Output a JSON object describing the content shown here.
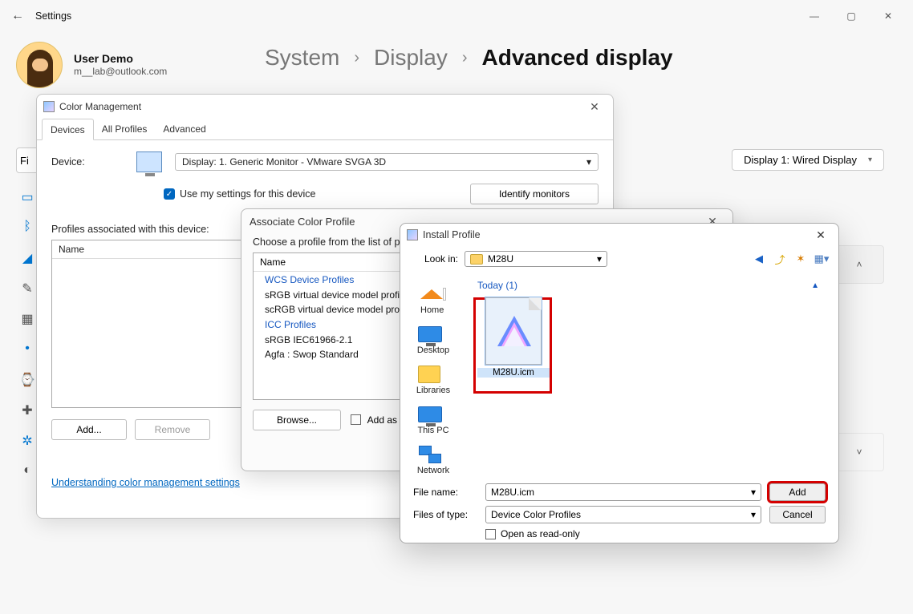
{
  "window": {
    "title": "Settings",
    "min": "—",
    "max": "▢",
    "close": "✕"
  },
  "user": {
    "name": "User Demo",
    "mail": "m__lab@outlook.com"
  },
  "breadcrumb": {
    "a": "System",
    "b": "Display",
    "c": "Advanced display"
  },
  "find_placeholder": "Fi",
  "display_selector": "Display 1: Wired Display",
  "color_mgmt": {
    "title": "Color Management",
    "tabs": {
      "devices": "Devices",
      "all": "All Profiles",
      "adv": "Advanced"
    },
    "device_lbl": "Device:",
    "device_val": "Display: 1. Generic Monitor - VMware SVGA 3D",
    "use_settings": "Use my settings for this device",
    "identify": "Identify monitors",
    "profiles_lbl": "Profiles associated with this device:",
    "list_head": "Name",
    "add": "Add...",
    "remove": "Remove",
    "link": "Understanding color management settings"
  },
  "assoc": {
    "title": "Associate Color Profile",
    "instr": "Choose a profile from the list of p",
    "head": "Name",
    "grp1": "WCS Device Profiles",
    "items1": [
      "sRGB virtual device model profil",
      "scRGB virtual device model prof"
    ],
    "grp2": "ICC Profiles",
    "items2": [
      "sRGB IEC61966-2.1",
      "Agfa : Swop Standard"
    ],
    "browse": "Browse...",
    "addas": "Add as"
  },
  "install": {
    "title": "Install Profile",
    "lookin_lbl": "Look in:",
    "lookin_val": "M28U",
    "places": {
      "home": "Home",
      "desktop": "Desktop",
      "libraries": "Libraries",
      "pc": "This PC",
      "network": "Network"
    },
    "group": "Today (1)",
    "file": "M28U.icm",
    "filename_lbl": "File name:",
    "filename_val": "M28U.icm",
    "filetype_lbl": "Files of type:",
    "filetype_val": "Device Color Profiles",
    "readonly": "Open as read-only",
    "add": "Add",
    "cancel": "Cancel"
  }
}
